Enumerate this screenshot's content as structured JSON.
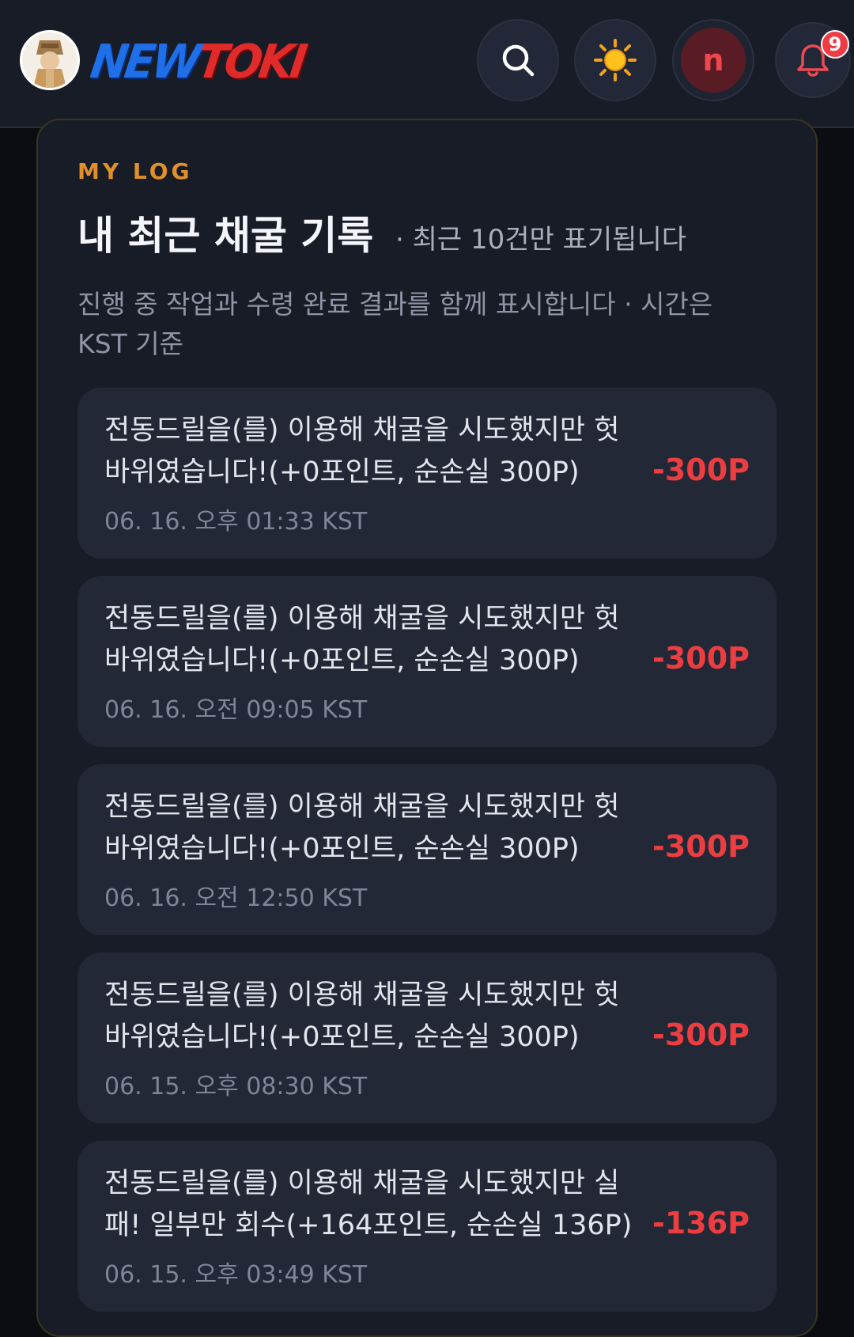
{
  "header": {
    "logo_new": "NEW",
    "logo_toki": "TOKI",
    "user_initial": "n",
    "notification_count": "9",
    "icons": [
      "search-icon",
      "sun-icon",
      "bell-icon"
    ]
  },
  "section": {
    "kicker": "MY LOG",
    "title": "내 최근 채굴 기록",
    "subnote": "· 최근 10건만 표기됩니다",
    "description": "진행 중 작업과 수령 완료 결과를 함께 표시합니다 · 시간은 KST 기준"
  },
  "logs": [
    {
      "message": "전동드릴을(를) 이용해 채굴을 시도했지만 헛바위였습니다!(+0포인트, 순손실 300P)",
      "time": "06. 16. 오후 01:33 KST",
      "amount": "-300P"
    },
    {
      "message": "전동드릴을(를) 이용해 채굴을 시도했지만 헛바위였습니다!(+0포인트, 순손실 300P)",
      "time": "06. 16. 오전 09:05 KST",
      "amount": "-300P"
    },
    {
      "message": "전동드릴을(를) 이용해 채굴을 시도했지만 헛바위였습니다!(+0포인트, 순손실 300P)",
      "time": "06. 16. 오전 12:50 KST",
      "amount": "-300P"
    },
    {
      "message": "전동드릴을(를) 이용해 채굴을 시도했지만 헛바위였습니다!(+0포인트, 순손실 300P)",
      "time": "06. 15. 오후 08:30 KST",
      "amount": "-300P"
    },
    {
      "message": "전동드릴을(를) 이용해 채굴을 시도했지만 실패! 일부만 회수(+164포인트, 순손실 136P)",
      "time": "06. 15. 오후 03:49 KST",
      "amount": "-136P"
    }
  ],
  "colors": {
    "accent": "#e0902a",
    "loss": "#ec3d40",
    "logo_blue": "#1f6fe8",
    "logo_red": "#e12a2a"
  }
}
